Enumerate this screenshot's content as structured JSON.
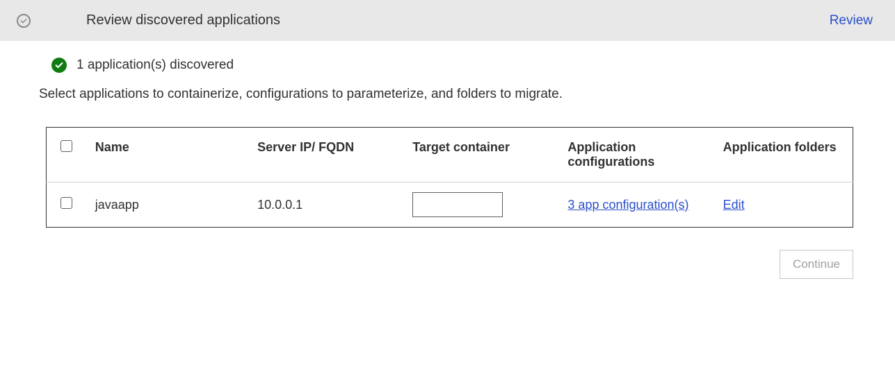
{
  "header": {
    "title": "Review discovered applications",
    "action_label": "Review"
  },
  "status": {
    "message": "1 application(s) discovered"
  },
  "instruction": "Select applications to containerize, configurations to parameterize, and folders to migrate.",
  "table": {
    "headers": {
      "name": "Name",
      "server": "Server IP/ FQDN",
      "target": "Target container",
      "config": "Application configurations",
      "folders": "Application folders"
    },
    "rows": [
      {
        "name": "javaapp",
        "server": "10.0.0.1",
        "target": "",
        "config_link": "3 app configuration(s)",
        "folders_link": "Edit"
      }
    ]
  },
  "footer": {
    "continue_label": "Continue"
  }
}
